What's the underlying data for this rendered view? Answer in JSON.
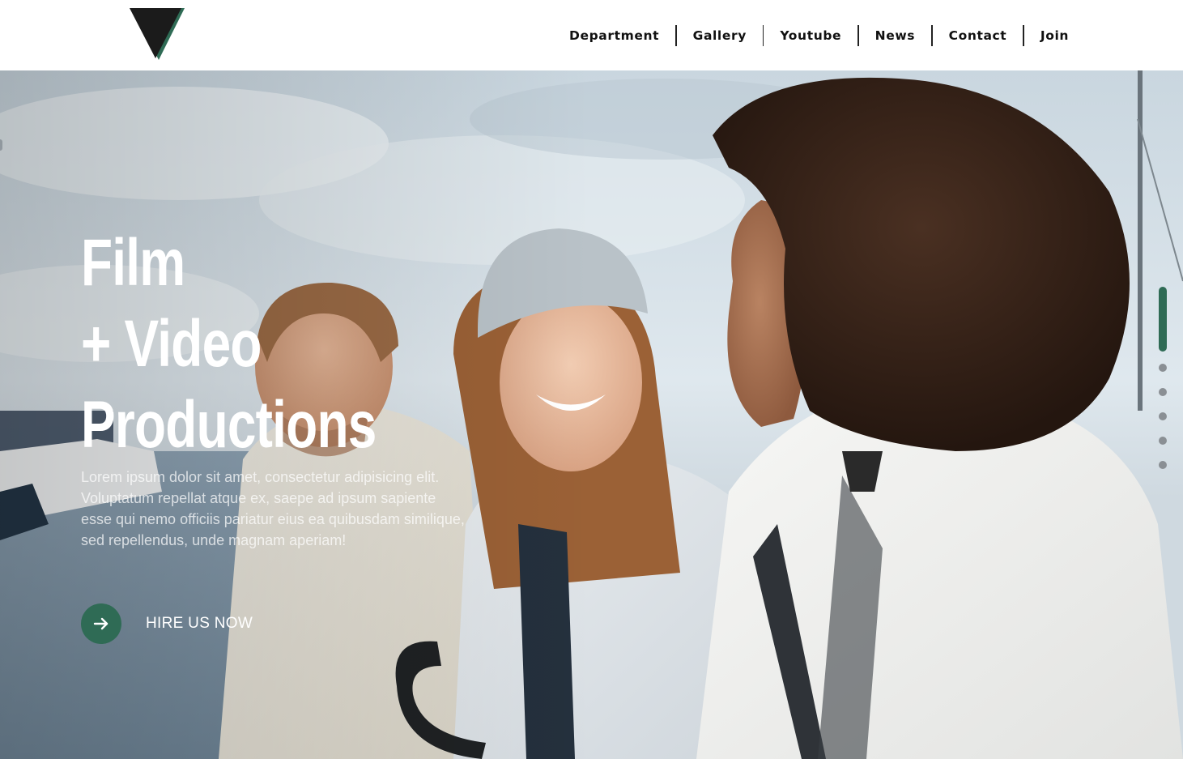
{
  "header": {
    "logo_icon": "triangle-logo-icon",
    "nav": [
      {
        "label": "Department"
      },
      {
        "label": "Gallery"
      },
      {
        "label": "Youtube"
      },
      {
        "label": "News"
      },
      {
        "label": "Contact"
      },
      {
        "label": "Join"
      }
    ]
  },
  "hero": {
    "title_lines": [
      "Film",
      "+ Video",
      "Productions"
    ],
    "description": "Lorem ipsum dolor sit amet, consectetur adipisicing elit. Voluptatum repellat atque ex, saepe ad ipsum sapiente esse qui nemo officiis pariatur eius ea quibusdam similique, sed repellendus, unde magnam aperiam!",
    "cta_label": "HIRE US NOW",
    "cta_icon": "arrow-right-icon",
    "background": "photo-three-friends-at-harbor",
    "slides": {
      "total": 6,
      "active": 1
    }
  },
  "colors": {
    "accent": "#2f6b55",
    "logo_dark": "#1b1b1b",
    "text_light": "#ffffff"
  }
}
